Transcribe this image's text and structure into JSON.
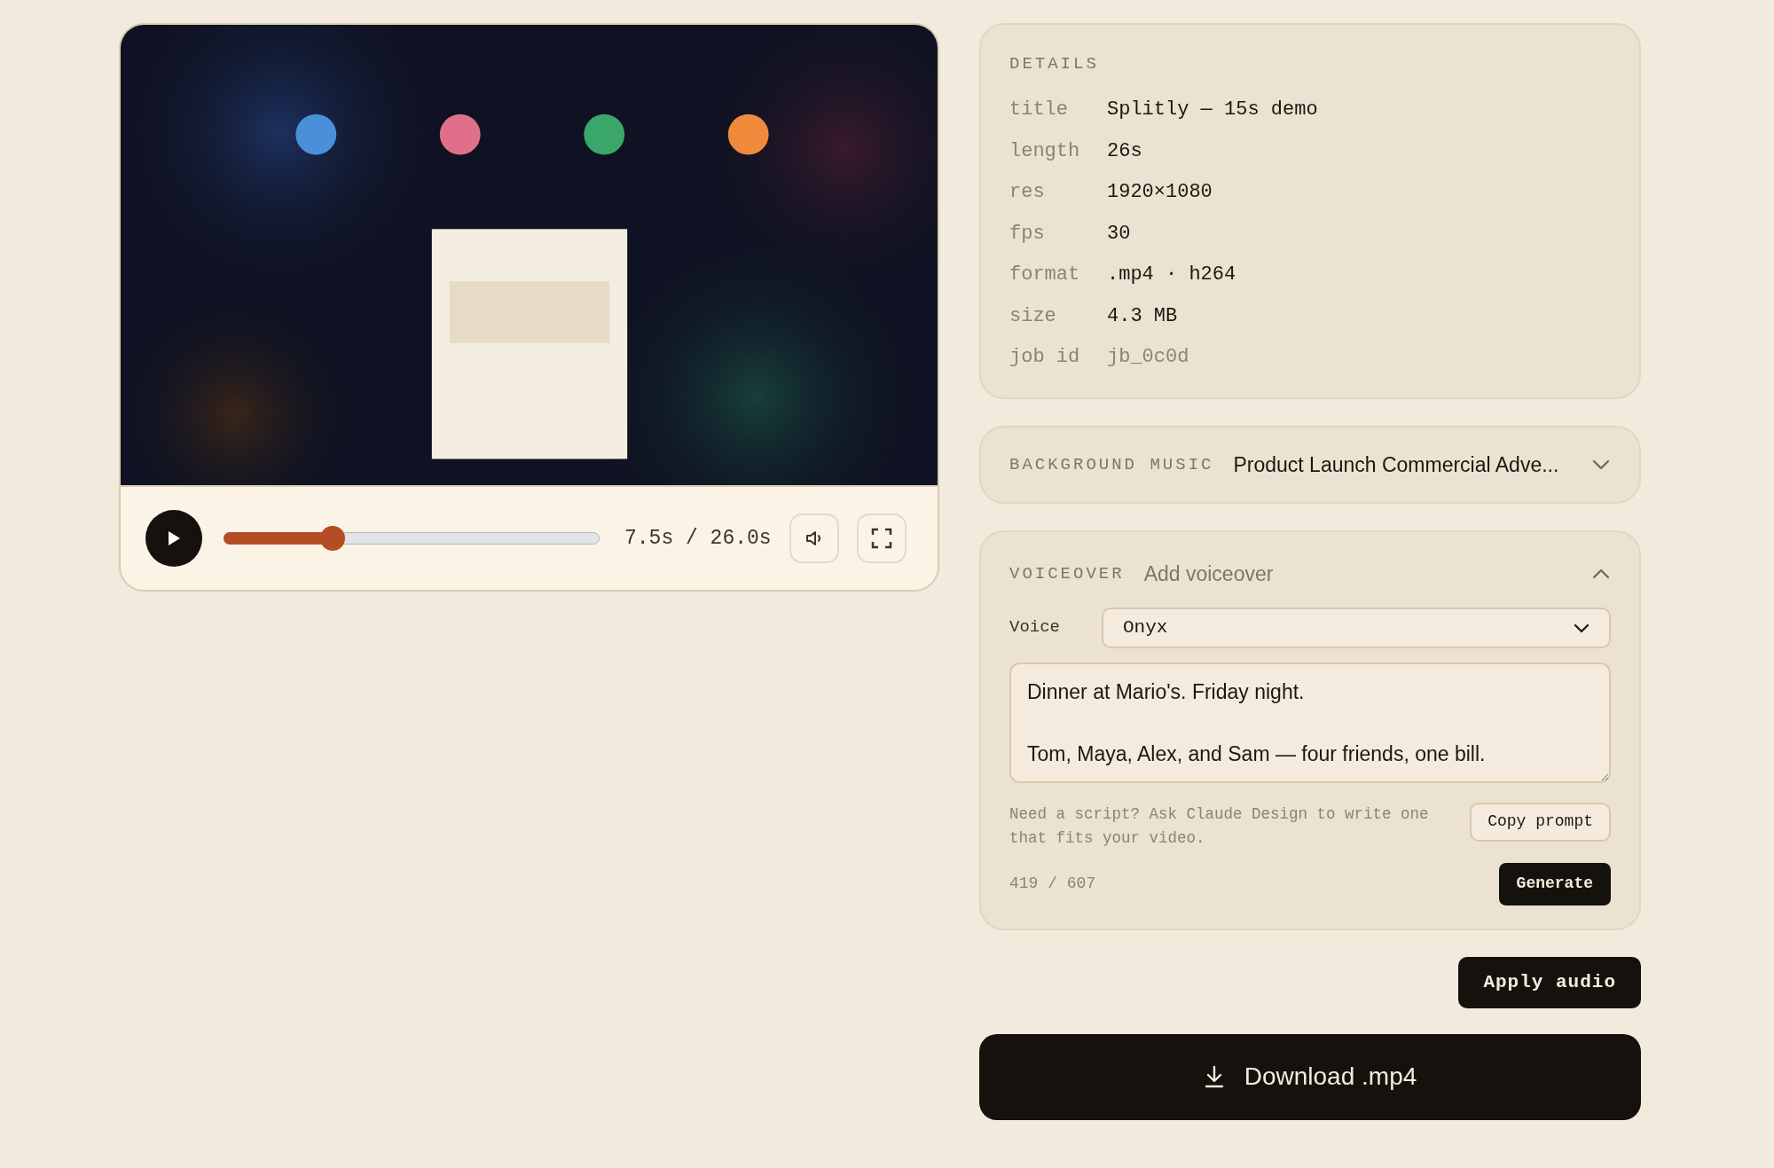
{
  "player": {
    "playing": false,
    "progress": {
      "level": 0.29
    },
    "time": "7.5s / 26.0s"
  },
  "details": {
    "heading": "DETAILS",
    "rows": [
      {
        "label": "title",
        "value": "Splitly — 15s demo",
        "muted": false
      },
      {
        "label": "length",
        "value": "26s",
        "muted": false
      },
      {
        "label": "res",
        "value": "1920×1080",
        "muted": false
      },
      {
        "label": "fps",
        "value": "30",
        "muted": false
      },
      {
        "label": "format",
        "value": ".mp4 · h264",
        "muted": false
      },
      {
        "label": "size",
        "value": "4.3 MB",
        "muted": false
      },
      {
        "label": "job id",
        "value": "jb_0c0d",
        "muted": true
      }
    ]
  },
  "background_music": {
    "heading": "BACKGROUND MUSIC",
    "value": "Product Launch Commercial Adve...",
    "expanded": false
  },
  "voiceover": {
    "heading": "VOICEOVER",
    "subtitle": "Add voiceover",
    "expanded": true,
    "voice_label": "Voice",
    "voice": "Onyx",
    "script": "Dinner at Mario's. Friday night.\n\nTom, Maya, Alex, and Sam — four friends, one bill.",
    "hint": "Need a script? Ask Claude Design to write one that fits your video.",
    "copy_button": "Copy prompt",
    "count": "419 / 607",
    "generate_button": "Generate"
  },
  "apply_button": "Apply audio",
  "download_button": "Download .mp4"
}
